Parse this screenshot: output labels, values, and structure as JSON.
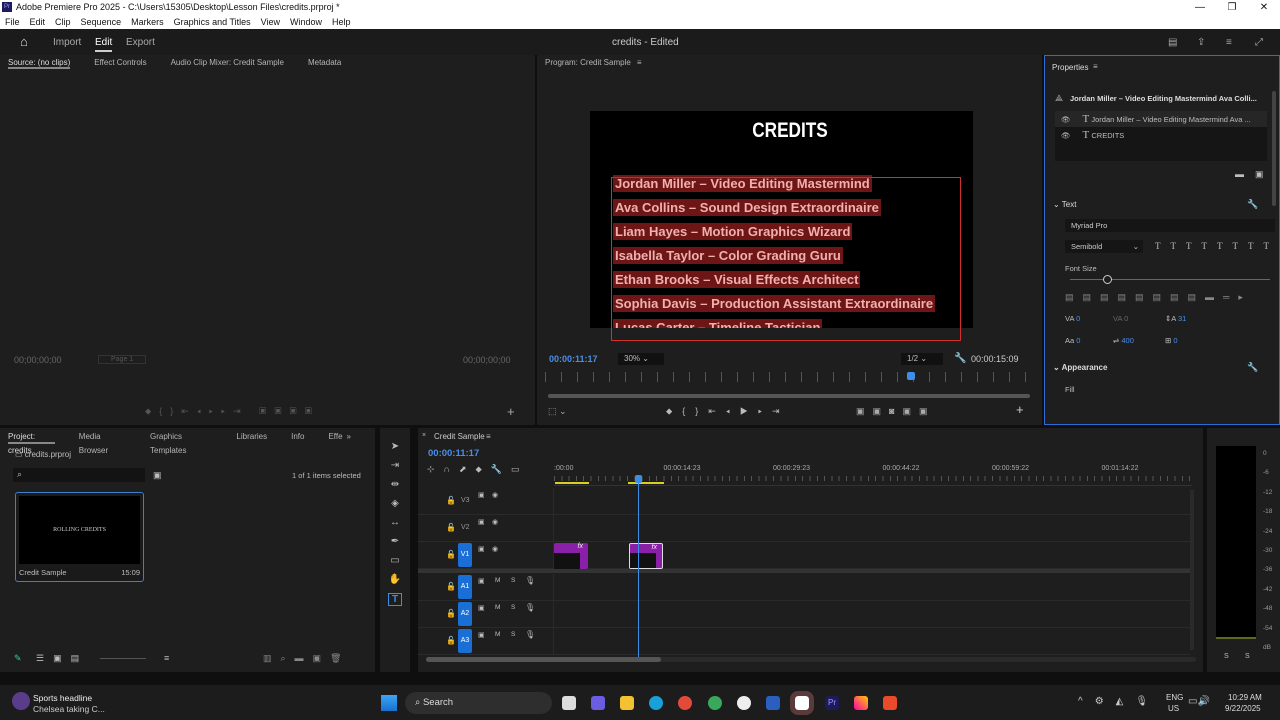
{
  "window": {
    "title": "Adobe Premiere Pro 2025 - C:\\Users\\15305\\Desktop\\Lesson Files\\credits.prproj *",
    "app_badge": "Pr",
    "min": "—",
    "max": "❐",
    "close": "✕"
  },
  "menu": [
    "File",
    "Edit",
    "Clip",
    "Sequence",
    "Markers",
    "Graphics and Titles",
    "View",
    "Window",
    "Help"
  ],
  "header": {
    "import": "Import",
    "edit": "Edit",
    "export": "Export",
    "doc_title": "credits - Edited"
  },
  "source": {
    "tabs": [
      "Source: (no clips)",
      "Effect Controls",
      "Audio Clip Mixer: Credit Sample",
      "Metadata"
    ],
    "timecode_left": "00;00;00;00",
    "page": "Page 1",
    "timecode_right": "00;00;00;00"
  },
  "program": {
    "tab": "Program: Credit Sample",
    "title_text": "CREDITS",
    "credits": [
      "Jordan Miller – Video Editing Mastermind",
      "Ava Collins – Sound Design Extraordinaire",
      "Liam Hayes – Motion Graphics Wizard",
      "Isabella Taylor – Color Grading Guru",
      "Ethan Brooks – Visual Effects Architect",
      "Sophia Davis – Production Assistant Extraordinaire",
      "Lucas Carter – Timeline Tactician"
    ],
    "timecode": "00:00:11:17",
    "zoom": "30%",
    "resolution": "1/2",
    "duration": "00:00:15:09",
    "playhead_fraction": 0.75
  },
  "properties": {
    "title": "Properties",
    "selection": "Jordan Miller – Video Editing Mastermind Ava Colli...",
    "layers": [
      "Jordan Miller – Video Editing Mastermind Ava ...",
      "CREDITS"
    ],
    "text_section": "Text",
    "font": "Myriad Pro",
    "style": "Semibold",
    "font_size_label": "Font Size",
    "kerning": "0",
    "tracking": "0",
    "leading": "31",
    "baseline": "0",
    "tsume": "400",
    "indent": "0",
    "appearance": "Appearance",
    "fill": "Fill"
  },
  "project": {
    "tabs": [
      "Project: credits",
      "Media Browser",
      "Graphics Templates",
      "Libraries",
      "Info",
      "Effe"
    ],
    "file": "credits.prproj",
    "selected_count": "1 of 1 items selected",
    "item": {
      "thumb_text": "ROLLING CREDITS",
      "name": "Credit Sample",
      "duration": "15:09"
    }
  },
  "timeline": {
    "tab": "Credit Sample",
    "timecode": "00:00:11:17",
    "ruler": [
      ":00:00",
      "00:00:14:23",
      "00:00:29:23",
      "00:00:44:22",
      "00:00:59:22",
      "00:01:14:22"
    ],
    "video_tracks": [
      "V3",
      "V2",
      "V1"
    ],
    "audio_tracks": [
      "A1",
      "A2",
      "A3"
    ],
    "mute": "M",
    "solo": "S",
    "fx": "fx"
  },
  "meter": {
    "scale": [
      "0",
      "-6",
      "-12",
      "-18",
      "-24",
      "-30",
      "-36",
      "-42",
      "-48",
      "-54",
      "dB"
    ],
    "solo": [
      "S",
      "S"
    ]
  },
  "taskbar": {
    "news_title": "Sports headline",
    "news_sub": "Chelsea taking C...",
    "search": "Search",
    "lang": "ENG",
    "region": "US",
    "time": "10:29 AM",
    "date": "9/22/2025"
  }
}
